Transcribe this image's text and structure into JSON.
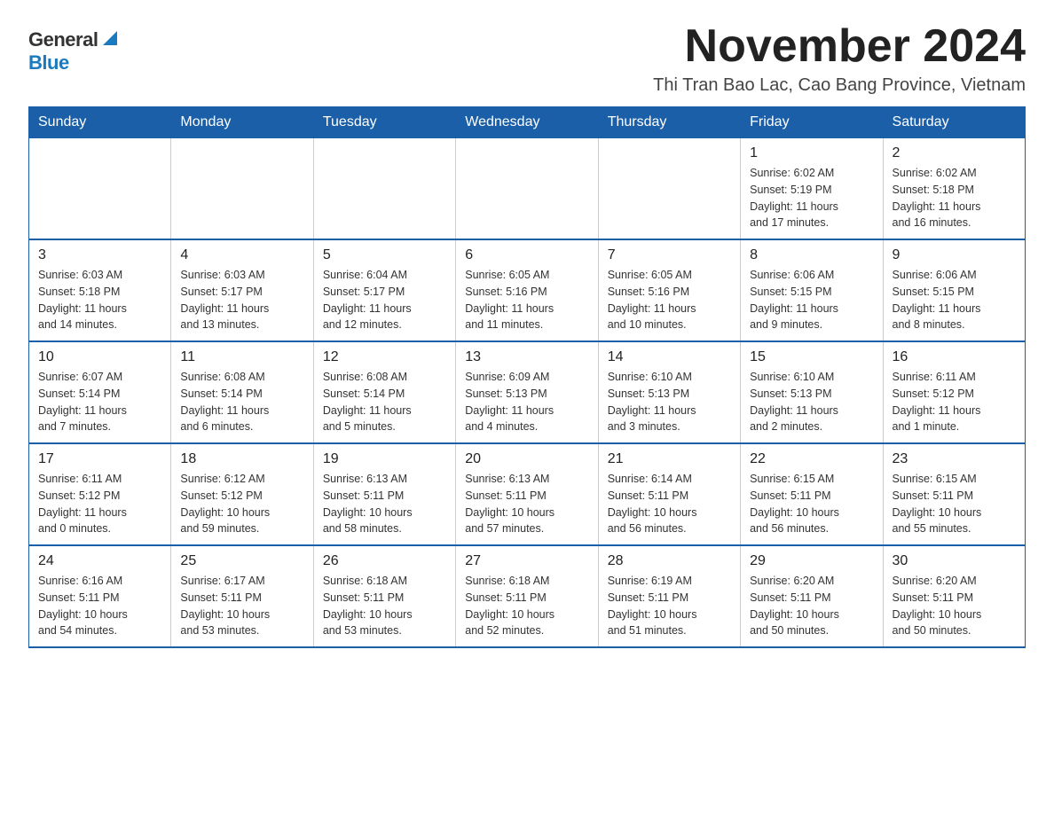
{
  "logo": {
    "general": "General",
    "blue": "Blue"
  },
  "header": {
    "month_title": "November 2024",
    "subtitle": "Thi Tran Bao Lac, Cao Bang Province, Vietnam"
  },
  "weekdays": [
    "Sunday",
    "Monday",
    "Tuesday",
    "Wednesday",
    "Thursday",
    "Friday",
    "Saturday"
  ],
  "weeks": [
    [
      {
        "day": "",
        "info": ""
      },
      {
        "day": "",
        "info": ""
      },
      {
        "day": "",
        "info": ""
      },
      {
        "day": "",
        "info": ""
      },
      {
        "day": "",
        "info": ""
      },
      {
        "day": "1",
        "info": "Sunrise: 6:02 AM\nSunset: 5:19 PM\nDaylight: 11 hours\nand 17 minutes."
      },
      {
        "day": "2",
        "info": "Sunrise: 6:02 AM\nSunset: 5:18 PM\nDaylight: 11 hours\nand 16 minutes."
      }
    ],
    [
      {
        "day": "3",
        "info": "Sunrise: 6:03 AM\nSunset: 5:18 PM\nDaylight: 11 hours\nand 14 minutes."
      },
      {
        "day": "4",
        "info": "Sunrise: 6:03 AM\nSunset: 5:17 PM\nDaylight: 11 hours\nand 13 minutes."
      },
      {
        "day": "5",
        "info": "Sunrise: 6:04 AM\nSunset: 5:17 PM\nDaylight: 11 hours\nand 12 minutes."
      },
      {
        "day": "6",
        "info": "Sunrise: 6:05 AM\nSunset: 5:16 PM\nDaylight: 11 hours\nand 11 minutes."
      },
      {
        "day": "7",
        "info": "Sunrise: 6:05 AM\nSunset: 5:16 PM\nDaylight: 11 hours\nand 10 minutes."
      },
      {
        "day": "8",
        "info": "Sunrise: 6:06 AM\nSunset: 5:15 PM\nDaylight: 11 hours\nand 9 minutes."
      },
      {
        "day": "9",
        "info": "Sunrise: 6:06 AM\nSunset: 5:15 PM\nDaylight: 11 hours\nand 8 minutes."
      }
    ],
    [
      {
        "day": "10",
        "info": "Sunrise: 6:07 AM\nSunset: 5:14 PM\nDaylight: 11 hours\nand 7 minutes."
      },
      {
        "day": "11",
        "info": "Sunrise: 6:08 AM\nSunset: 5:14 PM\nDaylight: 11 hours\nand 6 minutes."
      },
      {
        "day": "12",
        "info": "Sunrise: 6:08 AM\nSunset: 5:14 PM\nDaylight: 11 hours\nand 5 minutes."
      },
      {
        "day": "13",
        "info": "Sunrise: 6:09 AM\nSunset: 5:13 PM\nDaylight: 11 hours\nand 4 minutes."
      },
      {
        "day": "14",
        "info": "Sunrise: 6:10 AM\nSunset: 5:13 PM\nDaylight: 11 hours\nand 3 minutes."
      },
      {
        "day": "15",
        "info": "Sunrise: 6:10 AM\nSunset: 5:13 PM\nDaylight: 11 hours\nand 2 minutes."
      },
      {
        "day": "16",
        "info": "Sunrise: 6:11 AM\nSunset: 5:12 PM\nDaylight: 11 hours\nand 1 minute."
      }
    ],
    [
      {
        "day": "17",
        "info": "Sunrise: 6:11 AM\nSunset: 5:12 PM\nDaylight: 11 hours\nand 0 minutes."
      },
      {
        "day": "18",
        "info": "Sunrise: 6:12 AM\nSunset: 5:12 PM\nDaylight: 10 hours\nand 59 minutes."
      },
      {
        "day": "19",
        "info": "Sunrise: 6:13 AM\nSunset: 5:11 PM\nDaylight: 10 hours\nand 58 minutes."
      },
      {
        "day": "20",
        "info": "Sunrise: 6:13 AM\nSunset: 5:11 PM\nDaylight: 10 hours\nand 57 minutes."
      },
      {
        "day": "21",
        "info": "Sunrise: 6:14 AM\nSunset: 5:11 PM\nDaylight: 10 hours\nand 56 minutes."
      },
      {
        "day": "22",
        "info": "Sunrise: 6:15 AM\nSunset: 5:11 PM\nDaylight: 10 hours\nand 56 minutes."
      },
      {
        "day": "23",
        "info": "Sunrise: 6:15 AM\nSunset: 5:11 PM\nDaylight: 10 hours\nand 55 minutes."
      }
    ],
    [
      {
        "day": "24",
        "info": "Sunrise: 6:16 AM\nSunset: 5:11 PM\nDaylight: 10 hours\nand 54 minutes."
      },
      {
        "day": "25",
        "info": "Sunrise: 6:17 AM\nSunset: 5:11 PM\nDaylight: 10 hours\nand 53 minutes."
      },
      {
        "day": "26",
        "info": "Sunrise: 6:18 AM\nSunset: 5:11 PM\nDaylight: 10 hours\nand 53 minutes."
      },
      {
        "day": "27",
        "info": "Sunrise: 6:18 AM\nSunset: 5:11 PM\nDaylight: 10 hours\nand 52 minutes."
      },
      {
        "day": "28",
        "info": "Sunrise: 6:19 AM\nSunset: 5:11 PM\nDaylight: 10 hours\nand 51 minutes."
      },
      {
        "day": "29",
        "info": "Sunrise: 6:20 AM\nSunset: 5:11 PM\nDaylight: 10 hours\nand 50 minutes."
      },
      {
        "day": "30",
        "info": "Sunrise: 6:20 AM\nSunset: 5:11 PM\nDaylight: 10 hours\nand 50 minutes."
      }
    ]
  ]
}
